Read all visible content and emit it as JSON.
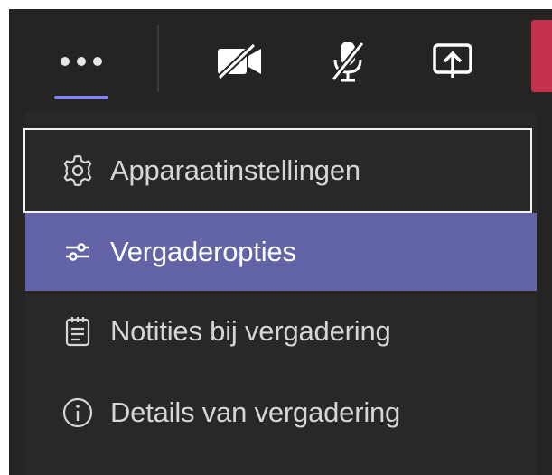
{
  "toolbar": {
    "buttons": [
      {
        "name": "more-actions",
        "icon": "more-dots-icon",
        "active": true
      },
      {
        "name": "camera",
        "icon": "camera-off-icon"
      },
      {
        "name": "microphone",
        "icon": "mic-off-icon"
      },
      {
        "name": "share",
        "icon": "share-tray-icon"
      }
    ],
    "colors": {
      "background": "#252423",
      "active_underline": "#7f85f5",
      "leave_button": "#c4314b"
    }
  },
  "menu": {
    "items": [
      {
        "label": "Apparaatinstellingen",
        "icon": "gear-icon",
        "focused": true
      },
      {
        "label": "Vergaderopties",
        "icon": "sliders-icon",
        "highlighted": true
      },
      {
        "label": "Notities bij vergadering",
        "icon": "notes-icon"
      },
      {
        "label": "Details van vergadering",
        "icon": "info-icon"
      }
    ],
    "colors": {
      "background": "#292827",
      "highlight": "#6264a7",
      "focus_border": "#f3f2f1",
      "text": "#d6d6d6"
    }
  }
}
